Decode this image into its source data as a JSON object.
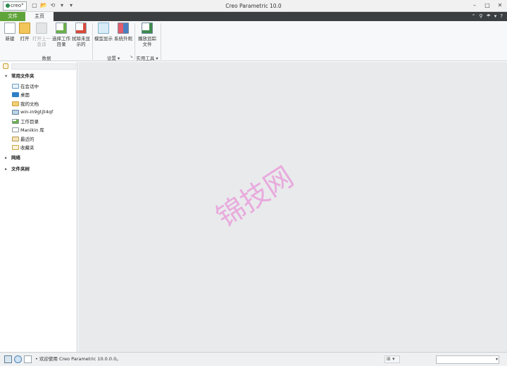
{
  "window": {
    "logo_text": "creo°",
    "title": "Creo Parametric 10.0",
    "controls": [
      "–",
      "□",
      "✕"
    ]
  },
  "quick_access": [
    "▢",
    "📂",
    "⟲",
    "▾",
    "▾"
  ],
  "tabs": {
    "file": "文件",
    "home": "主页"
  },
  "tab_icons": [
    "⌃",
    "⚲",
    "☂",
    "▾",
    "?"
  ],
  "ribbon": {
    "groups": [
      {
        "label": "数据"
      },
      {
        "label": "设置 ▾"
      },
      {
        "label": "实用工具 ▾"
      }
    ],
    "buttons": [
      {
        "label": "新建",
        "icon": "new-file-icon"
      },
      {
        "label": "打开",
        "icon": "open-folder-icon"
      },
      {
        "label": "打开上一\n会话",
        "icon": "open-last-session-icon",
        "disabled": true
      },
      {
        "label": "选择工作\n目录",
        "icon": "select-working-dir-icon"
      },
      {
        "label": "拭除未显\n示的",
        "icon": "erase-not-displayed-icon"
      },
      {
        "label": "模型显示",
        "icon": "model-display-icon"
      },
      {
        "label": "系统外观",
        "icon": "system-appearance-icon"
      },
      {
        "label": "播放追踪\n文件",
        "icon": "play-trail-file-icon"
      }
    ],
    "dialog_launcher": "↘"
  },
  "navigator": {
    "sections": {
      "common_folders": "常用文件夹",
      "network": "网络",
      "folder_tree": "文件夹树"
    },
    "items": [
      {
        "label": "在会话中",
        "icon": "in-session-icon"
      },
      {
        "label": "桌面",
        "icon": "desktop-icon"
      },
      {
        "label": "我的文档",
        "icon": "my-documents-icon"
      },
      {
        "label": "win-in9gtjli4qf",
        "icon": "computer-icon"
      },
      {
        "label": "工作目录",
        "icon": "working-directory-icon"
      },
      {
        "label": "Manikin 库",
        "icon": "manikin-library-icon"
      },
      {
        "label": "最近的",
        "icon": "recent-icon"
      },
      {
        "label": "收藏夹",
        "icon": "favorites-icon"
      }
    ]
  },
  "watermark": "锦技网",
  "status": {
    "message": "• 欢迎使用 Creo Parametric 10.0.0.0。",
    "find_label": "⊞ ▾"
  },
  "colors": {
    "file_tab": "#5fa43a",
    "tabbar": "#3b3f42",
    "main_bg": "#e9eaec",
    "watermark": "#e8a5dc"
  }
}
